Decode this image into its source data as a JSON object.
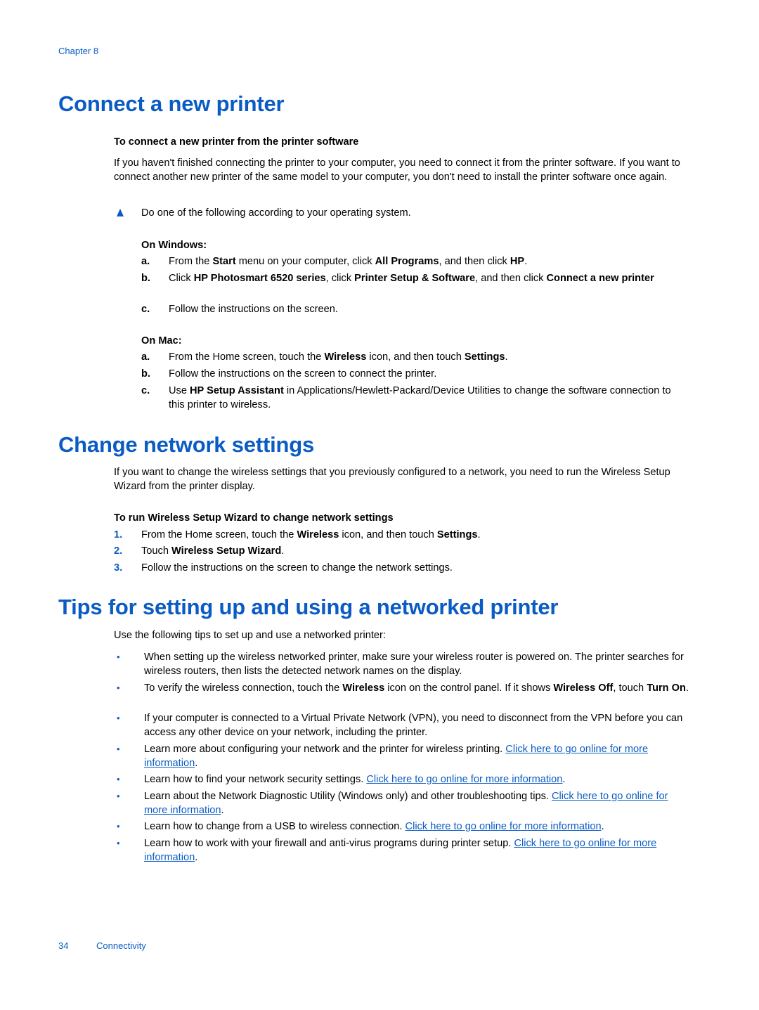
{
  "header": {
    "chapter": "Chapter 8"
  },
  "section1": {
    "title": "Connect a new printer",
    "procedure_heading": "To connect a new printer from the printer software",
    "intro": "If you haven't finished connecting the printer to your computer, you need to connect it from the printer software. If you want to connect another new printer of the same model to your computer, you don't need to install the printer software once again.",
    "step": "Do one of the following according to your operating system.",
    "windows": {
      "label": "On Windows:",
      "items": [
        {
          "marker": "a.",
          "parts": [
            "From the ",
            "Start",
            " menu on your computer, click ",
            "All Programs",
            ", and then click ",
            "HP",
            "."
          ]
        },
        {
          "marker": "b.",
          "parts": [
            "Click ",
            "HP Photosmart 6520 series",
            ", click ",
            "Printer Setup & Software",
            ", and then click ",
            "Connect a new printer",
            ""
          ]
        },
        {
          "marker": "c.",
          "text": "Follow the instructions on the screen."
        }
      ]
    },
    "mac": {
      "label": "On Mac:",
      "items": [
        {
          "marker": "a.",
          "parts": [
            "From the Home screen, touch the ",
            "Wireless",
            " icon, and then touch ",
            "Settings",
            "."
          ]
        },
        {
          "marker": "b.",
          "text": "Follow the instructions on the screen to connect the printer."
        },
        {
          "marker": "c.",
          "parts": [
            "Use ",
            "HP Setup Assistant",
            " in Applications/Hewlett-Packard/Device Utilities to change the software connection to this printer to wireless."
          ]
        }
      ]
    }
  },
  "section2": {
    "title": "Change network settings",
    "intro": "If you want to change the wireless settings that you previously configured to a network, you need to run the Wireless Setup Wizard from the printer display.",
    "procedure_heading": "To run Wireless Setup Wizard to change network settings",
    "steps": [
      {
        "marker": "1.",
        "parts": [
          "From the Home screen, touch the ",
          "Wireless",
          " icon, and then touch ",
          "Settings",
          "."
        ]
      },
      {
        "marker": "2.",
        "parts": [
          "Touch ",
          "Wireless Setup Wizard",
          "."
        ]
      },
      {
        "marker": "3.",
        "text": "Follow the instructions on the screen to change the network settings."
      }
    ]
  },
  "section3": {
    "title": "Tips for setting up and using a networked printer",
    "intro": "Use the following tips to set up and use a networked printer:",
    "bullet": "•",
    "tips": [
      {
        "text": "When setting up the wireless networked printer, make sure your wireless router is powered on. The printer searches for wireless routers, then lists the detected network names on the display."
      },
      {
        "parts": [
          "To verify the wireless connection, touch the ",
          "Wireless",
          " icon on the control panel. If it shows ",
          "Wireless Off",
          ", touch ",
          "Turn On",
          "."
        ]
      },
      {
        "text": "If your computer is connected to a Virtual Private Network (VPN), you need to disconnect from the VPN before you can access any other device on your network, including the printer."
      },
      {
        "text": "Learn more about configuring your network and the printer for wireless printing. ",
        "link": "Click here to go online for more information",
        "after": "."
      },
      {
        "text": "Learn how to find your network security settings. ",
        "link": "Click here to go online for more information",
        "after": "."
      },
      {
        "text": "Learn about the Network Diagnostic Utility (Windows only) and other troubleshooting tips. ",
        "link": "Click here to go online for more information",
        "after": "."
      },
      {
        "text": "Learn how to change from a USB to wireless connection. ",
        "link": "Click here to go online for more information",
        "after": "."
      },
      {
        "text": "Learn how to work with your firewall and anti-virus programs during printer setup. ",
        "link": "Click here to go online for more information",
        "after": "."
      }
    ]
  },
  "footer": {
    "page_number": "34",
    "section": "Connectivity"
  },
  "colors": {
    "accent": "#0a5cc4",
    "text": "#000000"
  }
}
